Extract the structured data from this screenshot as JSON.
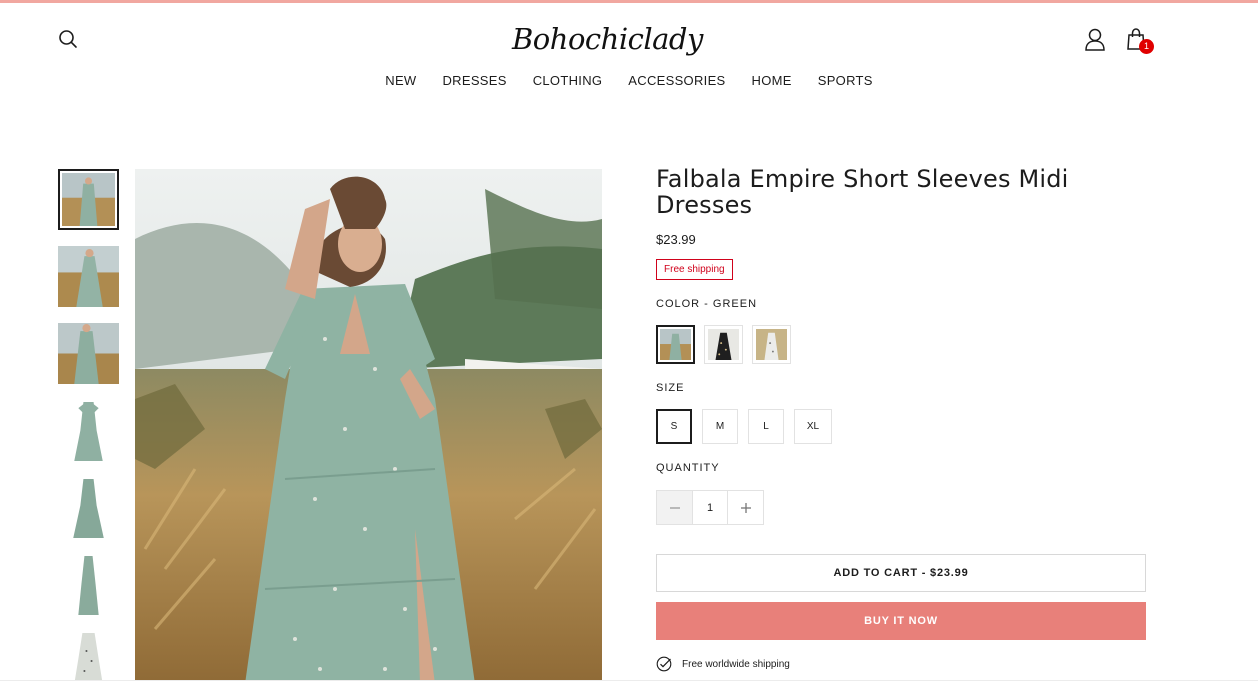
{
  "header": {
    "logo_text": "Bohochiclady",
    "cart_count": "1"
  },
  "nav": {
    "items": [
      "NEW",
      "DRESSES",
      "CLOTHING",
      "ACCESSORIES",
      "HOME",
      "SPORTS"
    ]
  },
  "product": {
    "title": "Falbala Empire Short Sleeves Midi Dresses",
    "price": "$23.99",
    "badge": "Free shipping",
    "color_label": "COLOR - GREEN",
    "size_label": "SIZE",
    "sizes": [
      "S",
      "M",
      "L",
      "XL"
    ],
    "selected_size": "S",
    "quantity_label": "QUANTITY",
    "quantity": "1",
    "add_to_cart": "ADD TO CART - $23.99",
    "buy_now": "BUY IT NOW",
    "worldwide_shipping": "Free worldwide shipping"
  },
  "colors": {
    "accent": "#e8807a",
    "badge_red": "#d0021b",
    "top_bar": "#f1a7a0",
    "cart_badge": "#e00000"
  }
}
